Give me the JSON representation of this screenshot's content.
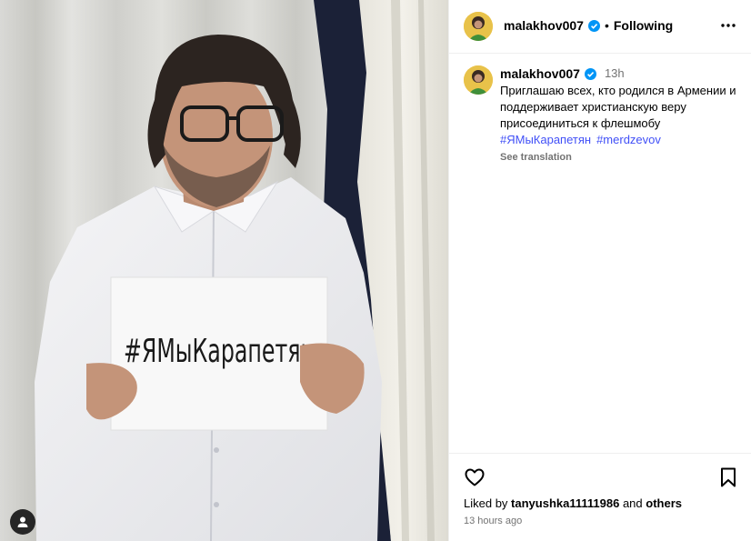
{
  "post": {
    "author": "malakhov007",
    "follow_status": "Following",
    "dot": "•",
    "more_icon": "more-horizontal-icon",
    "image": {
      "description_icon": "photo",
      "sign_text": "#ЯМыКарапетян"
    }
  },
  "caption": {
    "author": "malakhov007",
    "time": "13h",
    "text": "Приглашаю всех, кто родился в Армении и поддерживает христианскую веру присоединиться к флешмобу",
    "hashtags": [
      "#ЯМыКарапетян",
      "#merdzevov"
    ],
    "see_translation": "See translation"
  },
  "likes": {
    "prefix": "Liked by",
    "user": "tanyushka11111986",
    "conj": "and",
    "others": "others"
  },
  "timestamp": "13 hours ago",
  "colors": {
    "verified": "#0095f6",
    "hashtag": "#4150f7",
    "muted": "#737373"
  }
}
